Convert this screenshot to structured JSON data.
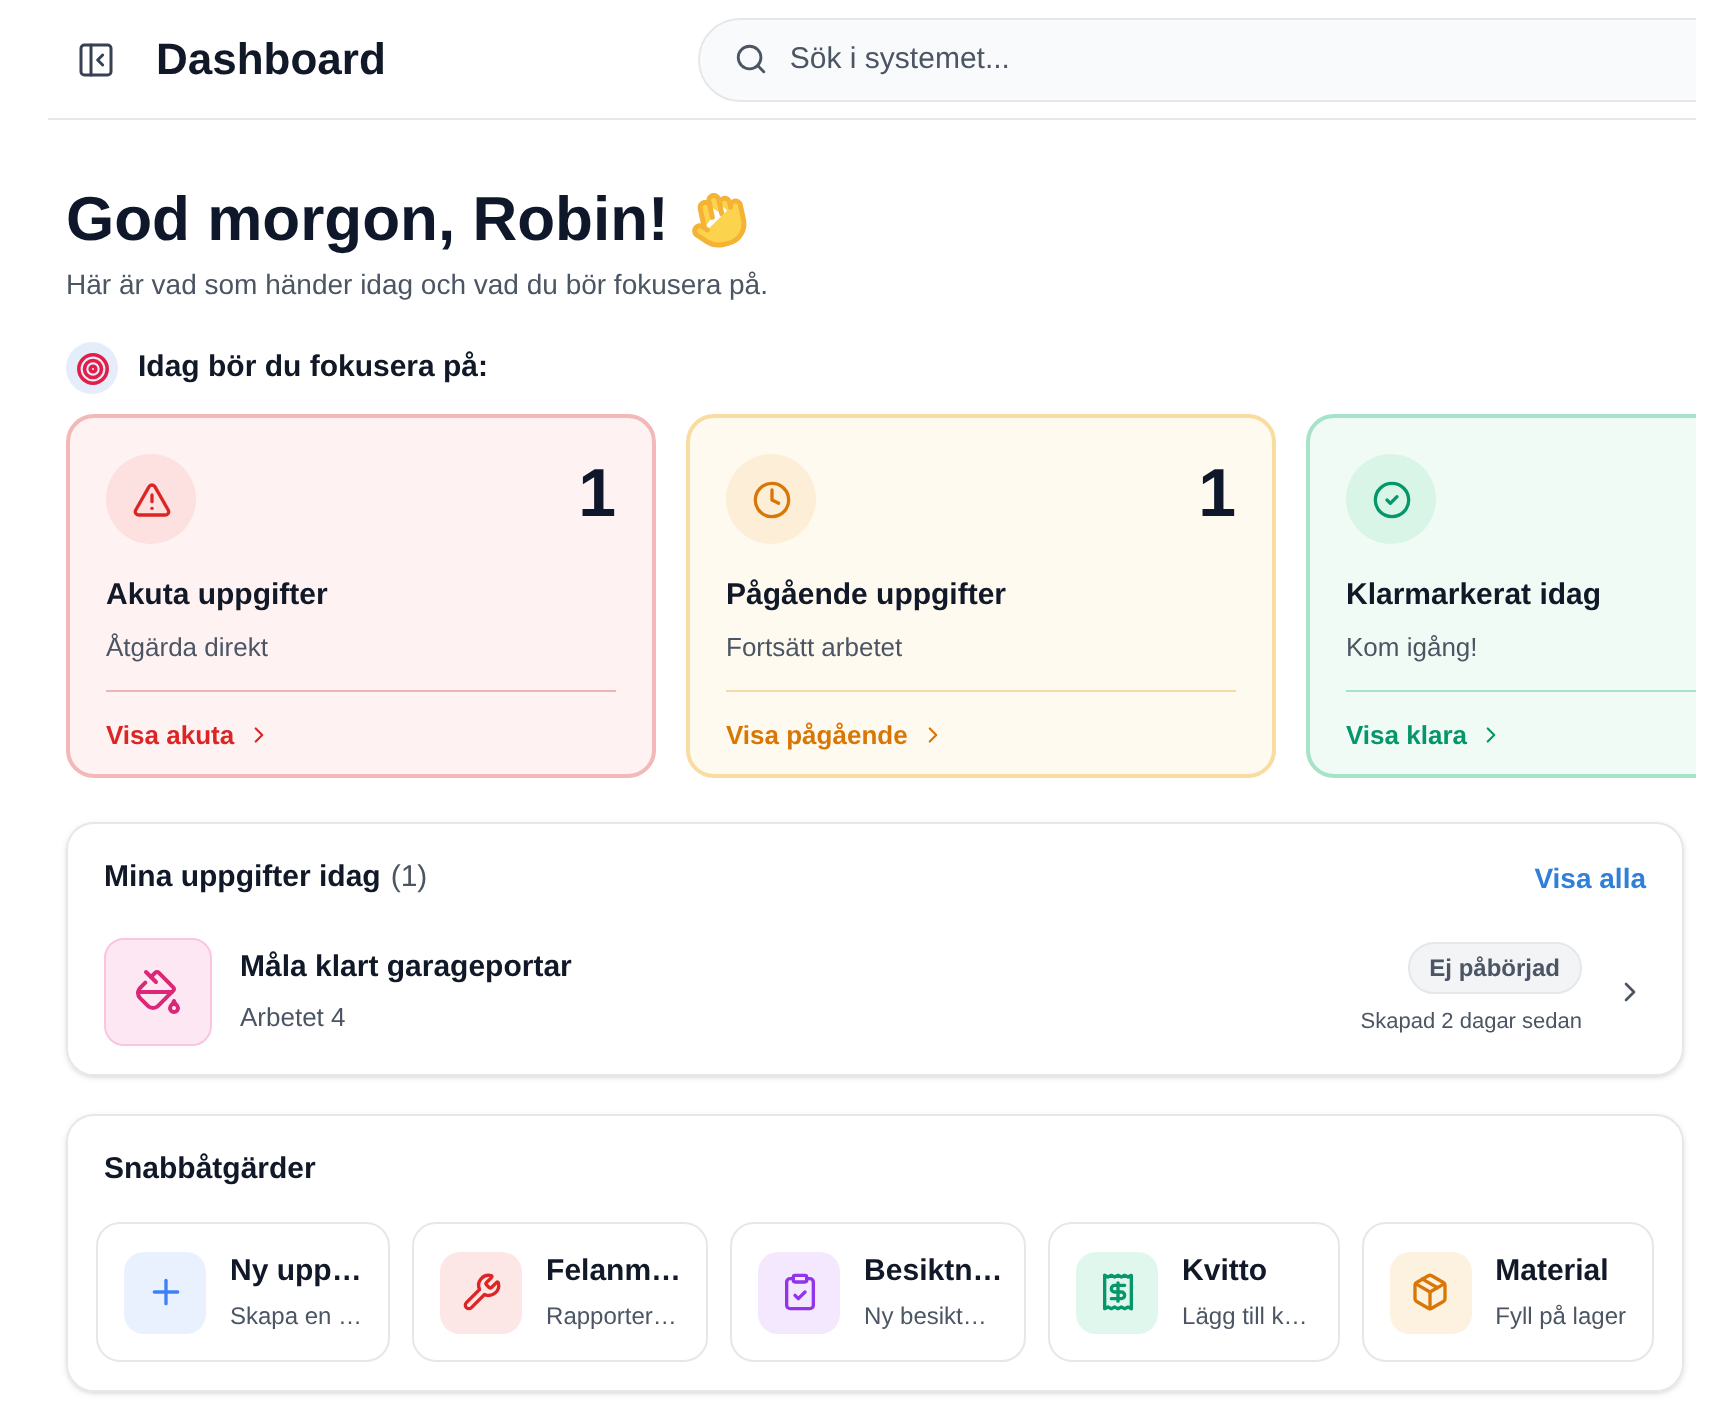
{
  "header": {
    "title": "Dashboard",
    "search": {
      "placeholder": "Sök i systemet..."
    }
  },
  "greeting": {
    "title": "God morgon, Robin!",
    "subtitle": "Här är vad som händer idag och vad du bör fokusera på."
  },
  "focus": {
    "heading": "Idag bör du fokusera på:",
    "cards": [
      {
        "kind": "urgent",
        "count": "1",
        "title": "Akuta uppgifter",
        "subtitle": "Åtgärda direkt",
        "link": "Visa akuta"
      },
      {
        "kind": "ongoing",
        "count": "1",
        "title": "Pågående uppgifter",
        "subtitle": "Fortsätt arbetet",
        "link": "Visa pågående"
      },
      {
        "kind": "done",
        "title": "Klarmarkerat idag",
        "subtitle": "Kom igång!",
        "link": "Visa klara"
      }
    ]
  },
  "tasks": {
    "title": "Mina uppgifter idag",
    "count": "(1)",
    "link": "Visa alla",
    "items": [
      {
        "title": "Måla klart garageportar",
        "subtitle": "Arbetet 4",
        "status": "Ej påbörjad",
        "created": "Skapad 2 dagar sedan"
      }
    ]
  },
  "quick_actions": {
    "title": "Snabbåtgärder",
    "items": [
      {
        "kind": "new",
        "title": "Ny upp…",
        "subtitle": "Skapa en …"
      },
      {
        "kind": "fault",
        "title": "Felanm…",
        "subtitle": "Rapporter…"
      },
      {
        "kind": "inspection",
        "title": "Besiktn…",
        "subtitle": "Ny besikt…"
      },
      {
        "kind": "receipt",
        "title": "Kvitto",
        "subtitle": "Lägg till k…"
      },
      {
        "kind": "material",
        "title": "Material",
        "subtitle": "Fyll på lager"
      }
    ]
  }
}
